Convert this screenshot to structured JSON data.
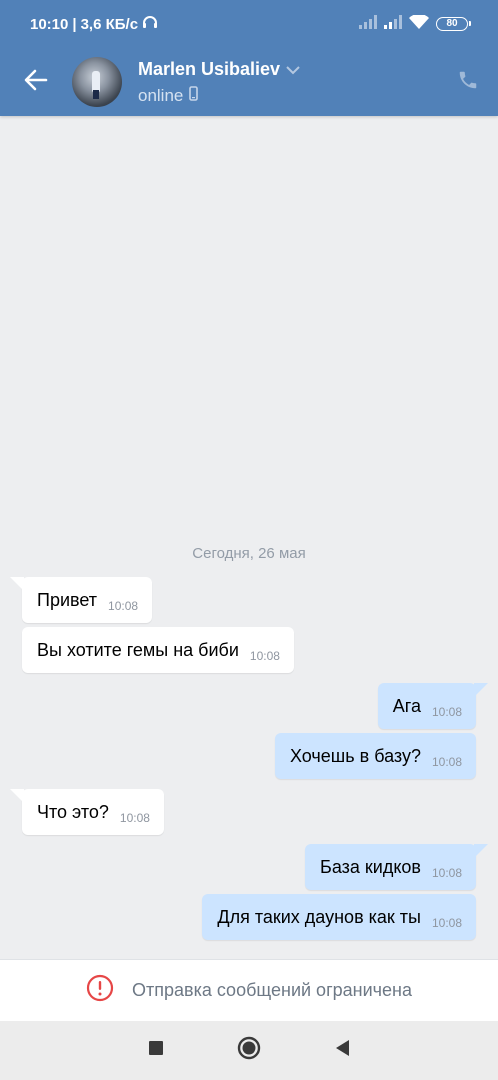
{
  "status_bar": {
    "time": "10:10",
    "network_speed": "3,6 КБ/с",
    "battery": "80"
  },
  "header": {
    "name": "Marlen Usibaliev",
    "status": "online"
  },
  "chat": {
    "date_separator": "Сегодня, 26 мая",
    "messages": [
      {
        "direction": "in",
        "text": "Привет",
        "time": "10:08"
      },
      {
        "direction": "in",
        "text": "Вы хотите гемы на биби",
        "time": "10:08"
      },
      {
        "direction": "out",
        "text": "Ага",
        "time": "10:08"
      },
      {
        "direction": "out",
        "text": "Хочешь в базу?",
        "time": "10:08"
      },
      {
        "direction": "in",
        "text": "Что это?",
        "time": "10:08"
      },
      {
        "direction": "out",
        "text": "База кидков",
        "time": "10:08"
      },
      {
        "direction": "out",
        "text": "Для таких даунов как ты",
        "time": "10:08"
      }
    ]
  },
  "footer": {
    "restriction_text": "Отправка сообщений ограничена"
  },
  "colors": {
    "header_bg": "#5181b8",
    "chat_bg": "#edeef0",
    "incoming_bubble": "#ffffff",
    "outgoing_bubble": "#cce4ff",
    "alert_red": "#e64646"
  },
  "icons": {
    "back": "arrow-left-icon",
    "dropdown": "chevron-down-icon",
    "mobile": "mobile-device-icon",
    "phone": "phone-icon",
    "alert": "alert-circle-icon",
    "nav_recent": "square-icon",
    "nav_home": "circle-icon",
    "nav_back": "triangle-back-icon"
  }
}
